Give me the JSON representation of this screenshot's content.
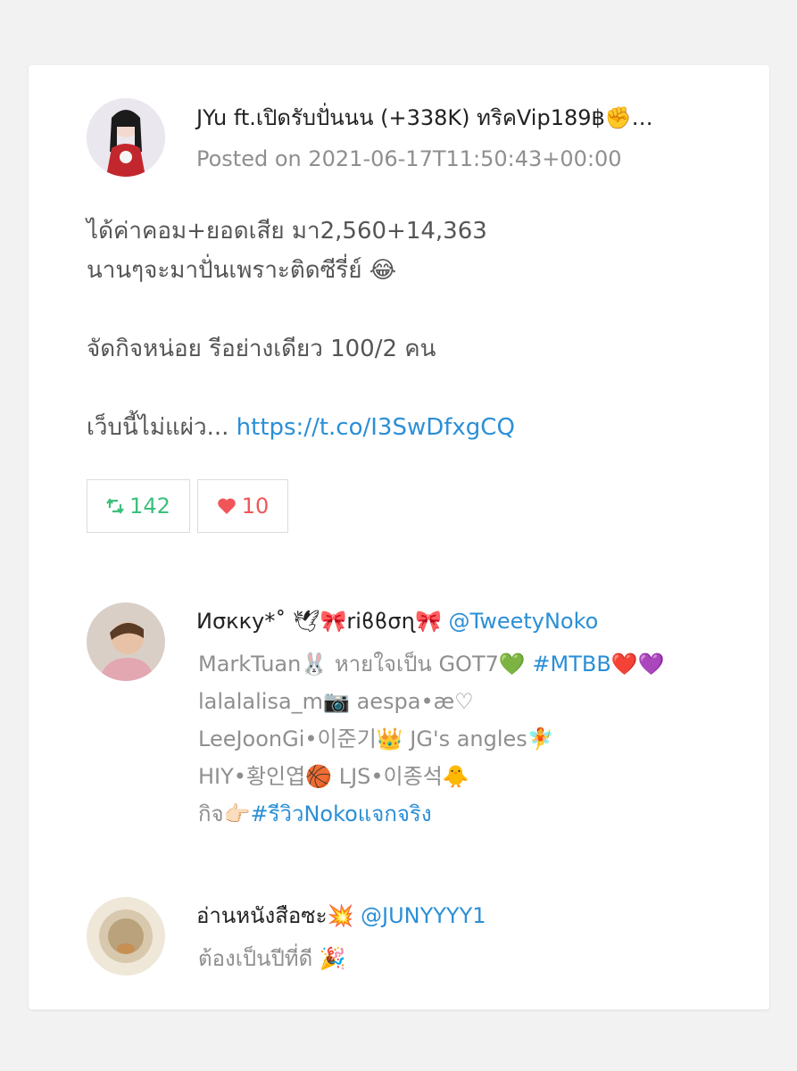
{
  "post": {
    "author_name": "JYu ft.เปิดรับปั่นนน (+338K) ทริคVip189฿✊…",
    "posted_on": "Posted on 2021-06-17T11:50:43+00:00",
    "lines": [
      "ได้ค่าคอม+ยอดเสีย มา2,560+14,363",
      "นานๆจะมาปั่นเพราะติดซีรี่ย์ 😂",
      "จัดกิจหน่อย รีอย่างเดียว 100/2 คน"
    ],
    "last_line_prefix": "เว็บนี้ไม่แผ่ว... ",
    "link": "https://t.co/I3SwDfxgCQ",
    "retweet_count": "142",
    "like_count": "10"
  },
  "users": [
    {
      "name": "Иσкку*˚ 🕊🎀riϐϐσɳ🎀",
      "handle": "@TweetyNoko",
      "bio": [
        {
          "text": "MarkTuan🐰 หายใจเป็น GOT7💚 ",
          "tag": "#MTBB",
          "after": "❤️💜"
        },
        {
          "text": "lalalalisa_m📷 aespa•æ♡"
        },
        {
          "text": "LeeJoonGi•이준기👑 JG's angles🧚"
        },
        {
          "text": "HIY•황인엽🏀 LJS•이종석🐥"
        },
        {
          "text": "กิจ👉🏻",
          "tag": "#รีวิวNokoแจกจริง"
        }
      ]
    },
    {
      "name": "อ่านหนังสือซะ💥",
      "handle": "@JUNYYYY1",
      "bio": [
        {
          "text": "ต้องเป็นปีที่ดี 🎉"
        }
      ]
    }
  ],
  "colors": {
    "link": "#2b8fd6",
    "retweet": "#3cbf7c",
    "like": "#f0555a"
  }
}
